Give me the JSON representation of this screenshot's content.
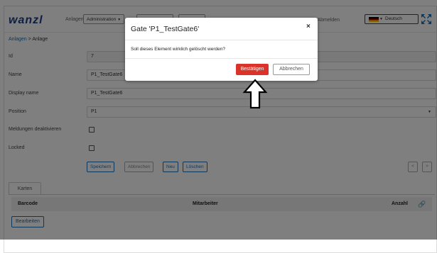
{
  "header": {
    "logo": "wanzl",
    "nav": {
      "anlagen": "Anlagen",
      "administration": "Administration"
    },
    "logout": "Abmelden",
    "language": "Deutsch"
  },
  "breadcrumb": {
    "root": "Anlagen",
    "sep": ">",
    "current": "Anlage"
  },
  "form": {
    "id": {
      "label": "Id",
      "value": "7"
    },
    "name": {
      "label": "Name",
      "value": "P1_TestGate6"
    },
    "display_name": {
      "label": "Display name",
      "value": "P1_TestGate6"
    },
    "position": {
      "label": "Position",
      "value": "P1"
    },
    "meldungen": {
      "label": "Meldungen deaktivieren"
    },
    "locked": {
      "label": "Locked"
    }
  },
  "actions": {
    "save": "Speichern",
    "cancel": "Abbrechen",
    "new": "Neu",
    "delete": "Löschen",
    "prev": "<",
    "next": ">"
  },
  "tabs": {
    "cards": "Karten"
  },
  "table": {
    "columns": [
      "Barcode",
      "Mitarbeiter",
      "Anzahl"
    ]
  },
  "edit_button": "Bearbeiten",
  "modal": {
    "title": "Gate 'P1_TestGate6'",
    "close": "×",
    "message": "Soll dieses Element wirklich gelöscht werden?",
    "confirm": "Bestätigen",
    "cancel": "Abbrechen"
  },
  "colors": {
    "brand": "#1b3f86",
    "link": "#1a6fb6",
    "danger": "#d9342b",
    "overlay": "rgba(0,0,0,0.5)"
  }
}
